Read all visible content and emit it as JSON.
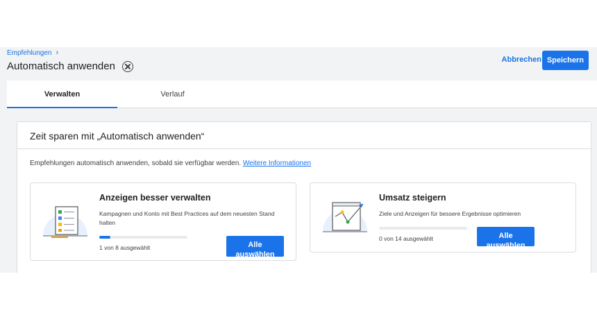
{
  "header": {
    "breadcrumb": "Empfehlungen",
    "title": "Automatisch anwenden",
    "cancel_label": "Abbrechen",
    "save_label": "Speichern"
  },
  "tabs": [
    {
      "label": "Verwalten",
      "active": true
    },
    {
      "label": "Verlauf",
      "active": false
    }
  ],
  "main": {
    "card_title": "Zeit sparen mit „Automatisch anwenden“",
    "description": "Empfehlungen automatisch anwenden, sobald sie verfügbar werden.",
    "learn_more": "Weitere Informationen",
    "cards": [
      {
        "title": "Anzeigen besser verwalten",
        "subtitle": "Kampagnen und Konto mit Best Practices auf dem neuesten Stand halten",
        "selected": 1,
        "total": 8,
        "count_text": "1 von 8 ausgewählt",
        "button_label": "Alle auswählen",
        "icon": "checklist-icon"
      },
      {
        "title": "Umsatz steigern",
        "subtitle": "Ziele und Anzeigen für bessere Ergebnisse optimieren",
        "selected": 0,
        "total": 14,
        "count_text": "0 von 14 ausgewählt",
        "button_label": "Alle auswählen",
        "icon": "growth-chart-icon"
      }
    ]
  },
  "colors": {
    "accent": "#1a73e8",
    "background": "#f1f3f4",
    "border": "#dadce0"
  }
}
